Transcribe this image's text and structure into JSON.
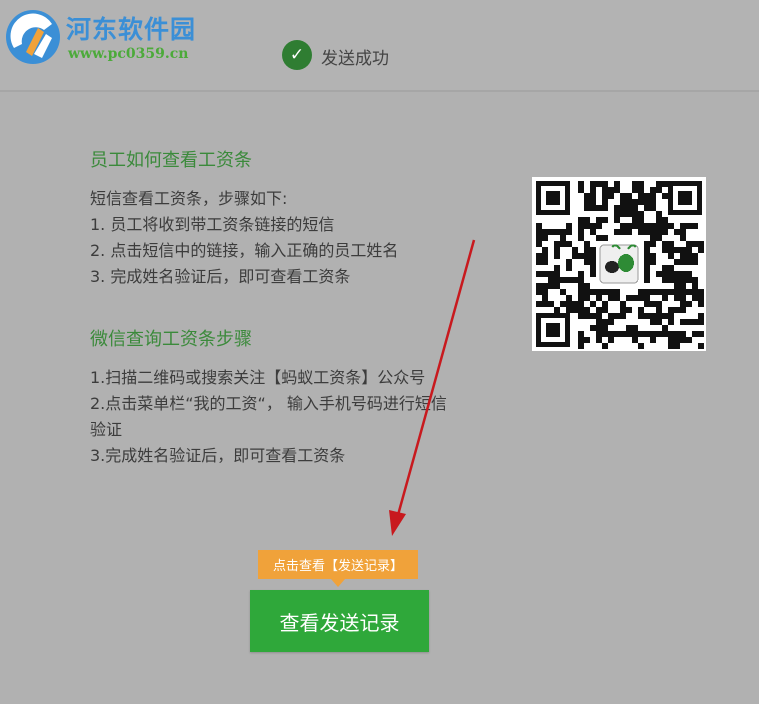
{
  "watermark": {
    "title": "河东软件园",
    "url": "www.pc0359.cn"
  },
  "status": {
    "icon": "check-icon",
    "text": "发送成功"
  },
  "section1": {
    "title": "员工如何查看工资条",
    "lines": [
      "短信查看工资条，步骤如下:",
      "1. 员工将收到带工资条链接的短信",
      "2. 点击短信中的链接，输入正确的员工姓名",
      "3. 完成姓名验证后，即可查看工资条"
    ]
  },
  "section2": {
    "title": "微信查询工资条步骤",
    "lines": [
      "1.扫描二维码或搜索关注【蚂蚁工资条】公众号",
      "2.点击菜单栏“我的工资“， 输入手机号码进行短信验证",
      "3.完成姓名验证后，即可查看工资条"
    ]
  },
  "qr": {
    "icon": "qr-code-icon",
    "center_logo": "ant-logo-icon"
  },
  "tip": {
    "text": "点击查看【发送记录】"
  },
  "view_button": {
    "label": "查看发送记录"
  },
  "colors": {
    "background": "#b1b1b1",
    "accent_green": "#2fa83a",
    "title_green": "#3b8a3b",
    "tip_orange": "#f0a23a",
    "annotation_red": "#c8191e"
  }
}
